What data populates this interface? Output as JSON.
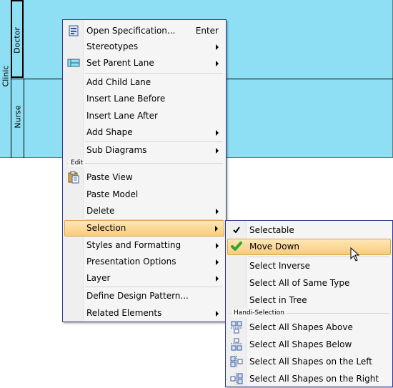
{
  "diagram": {
    "pool_label": "Clinic",
    "lanes": [
      "Doctor",
      "Nurse"
    ]
  },
  "context_menu": {
    "items": [
      {
        "label": "Open Specification...",
        "shortcut": "Enter",
        "icon": "specification-icon"
      },
      {
        "label": "Stereotypes"
      },
      {
        "label": "Set Parent Lane",
        "icon": "lane-icon"
      },
      {
        "label": "Add Child Lane"
      },
      {
        "label": "Insert Lane Before"
      },
      {
        "label": "Insert Lane After"
      },
      {
        "label": "Add Shape"
      },
      {
        "label": "Sub Diagrams"
      },
      {
        "label": "Paste View",
        "icon": "paste-icon"
      },
      {
        "label": "Paste Model"
      },
      {
        "label": "Delete"
      },
      {
        "label": "Selection"
      },
      {
        "label": "Styles and Formatting"
      },
      {
        "label": "Presentation Options"
      },
      {
        "label": "Layer"
      },
      {
        "label": "Define Design Pattern..."
      },
      {
        "label": "Related Elements"
      }
    ],
    "group_edit": "Edit"
  },
  "submenu": {
    "items": [
      {
        "label": "Selectable",
        "icon": "checkmark-icon"
      },
      {
        "label": "Move Down",
        "icon": "green-check-icon"
      },
      {
        "label": "Select Inverse"
      },
      {
        "label": "Select All of Same Type"
      },
      {
        "label": "Select in Tree"
      },
      {
        "label": "Select All Shapes Above",
        "icon": "select-above-icon"
      },
      {
        "label": "Select All Shapes Below",
        "icon": "select-below-icon"
      },
      {
        "label": "Select All Shapes on the Left",
        "icon": "select-left-icon"
      },
      {
        "label": "Select All Shapes on the Right",
        "icon": "select-right-icon"
      }
    ],
    "group_handi": "Handi-Selection"
  },
  "colors": {
    "canvas": "#8edff3",
    "highlight": "#f8cc7a",
    "menu_border": "#2b3a8c"
  }
}
